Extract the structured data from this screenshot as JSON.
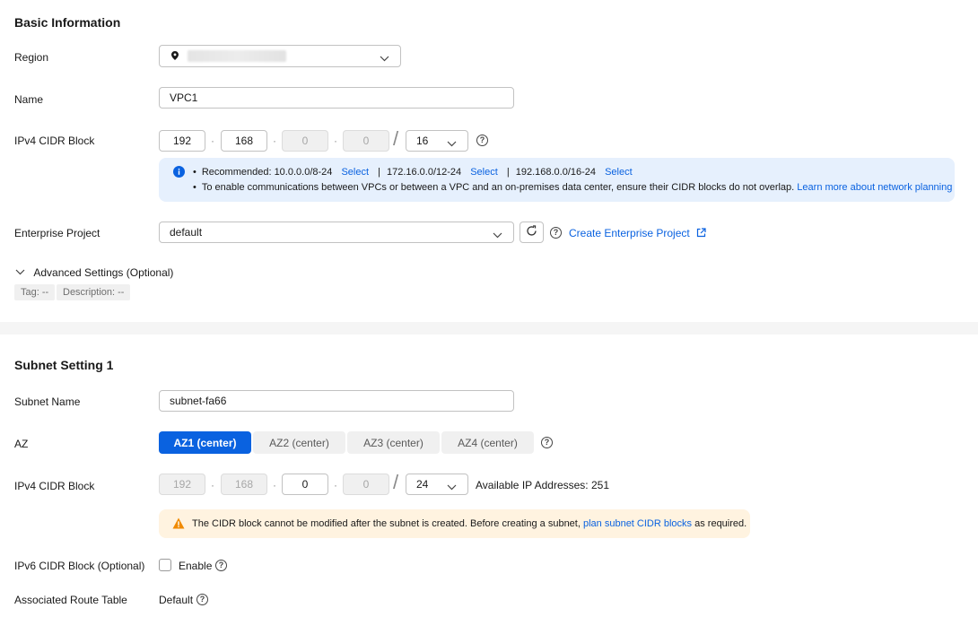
{
  "basic": {
    "title": "Basic Information",
    "region_label": "Region",
    "region_value": "",
    "name_label": "Name",
    "name_value": "VPC1",
    "ipv4_label": "IPv4 CIDR Block",
    "cidr": {
      "oct1": "192",
      "oct2": "168",
      "oct3": "0",
      "oct4": "0",
      "mask": "16"
    },
    "recommend": {
      "prefix": "Recommended: 10.0.0.0/8-24",
      "select1": "Select",
      "sep1": "|",
      "opt2": "172.16.0.0/12-24",
      "select2": "Select",
      "sep2": "|",
      "opt3": "192.168.0.0/16-24",
      "select3": "Select",
      "line2": "To enable communications between VPCs or between a VPC and an on-premises data center, ensure their CIDR blocks do not overlap.",
      "line2_link": "Learn more about network planning"
    },
    "enterprise_label": "Enterprise Project",
    "enterprise_value": "default",
    "create_enterprise": "Create Enterprise Project",
    "advanced_label": "Advanced Settings (Optional)",
    "tag_chip": "Tag: --",
    "desc_chip": "Description: --"
  },
  "subnet": {
    "title": "Subnet Setting 1",
    "name_label": "Subnet Name",
    "name_value": "subnet-fa66",
    "az_label": "AZ",
    "az_options": [
      "AZ1 (center)",
      "AZ2 (center)",
      "AZ3 (center)",
      "AZ4 (center)"
    ],
    "az_selected": "AZ1 (center)",
    "ipv4_label": "IPv4 CIDR Block",
    "cidr": {
      "oct1": "192",
      "oct2": "168",
      "oct3": "0",
      "oct4": "0",
      "mask": "24"
    },
    "available_ips": "Available IP Addresses: 251",
    "warning_text": "The CIDR block cannot be modified after the subnet is created. Before creating a subnet,",
    "warning_link": "plan subnet CIDR blocks",
    "warning_suffix": "as required.",
    "ipv6_label": "IPv6 CIDR Block (Optional)",
    "ipv6_enable": "Enable",
    "route_label": "Associated Route Table",
    "route_value": "Default"
  },
  "colors": {
    "accent": "#0a62e0",
    "info_bg": "#e6f0fd",
    "warn_bg": "#fff3e0",
    "warn_icon": "#f08a00"
  }
}
